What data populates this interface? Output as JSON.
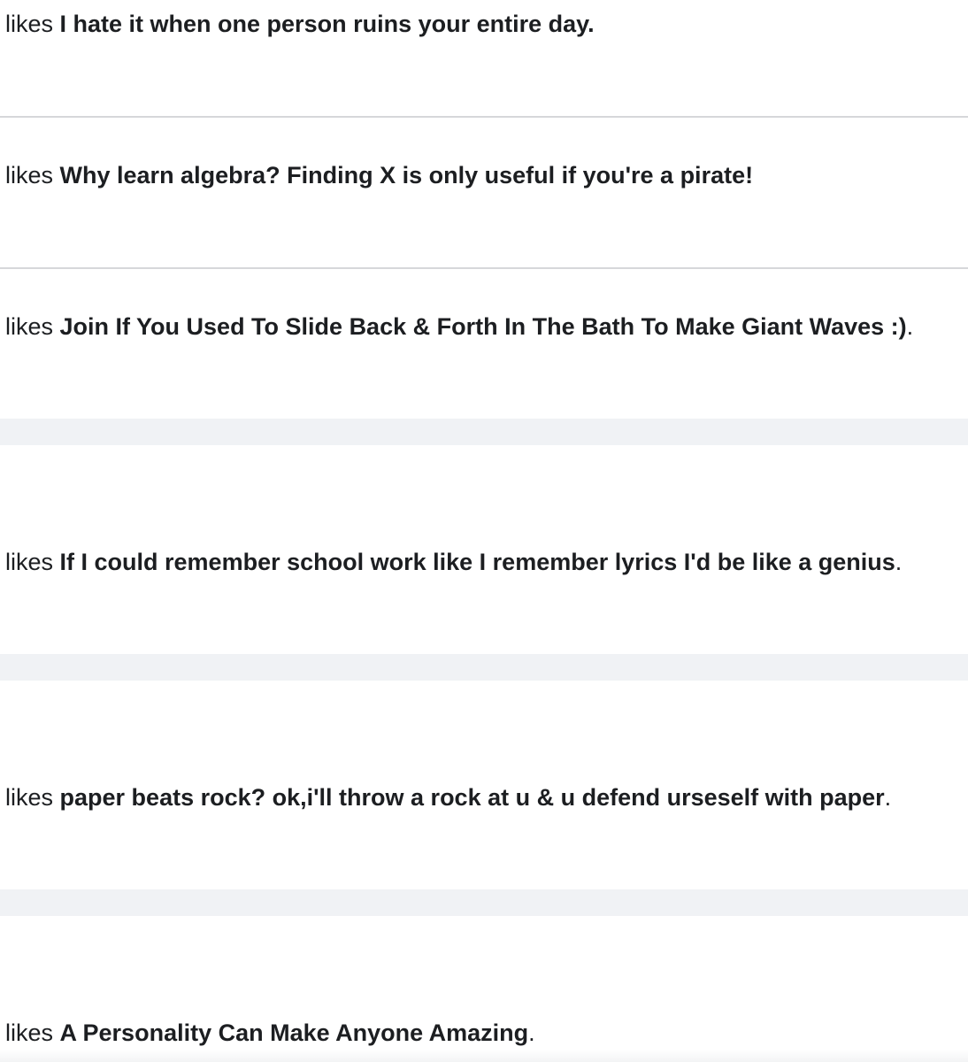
{
  "activity": [
    {
      "verb": "likes",
      "page": "I hate it when one person ruins your entire day",
      "end": "."
    },
    {
      "verb": "likes",
      "page": "Why learn algebra? Finding X is only useful if you're a pirate!",
      "end": ""
    },
    {
      "verb": "likes",
      "page": "Join If You Used To Slide Back & Forth In The Bath To Make Giant Waves :)",
      "end": "."
    },
    {
      "verb": "likes",
      "page": "If I could remember school work like I remember lyrics I'd be like a genius",
      "end": "."
    },
    {
      "verb": "likes",
      "page": "paper beats rock? ok,i'll throw a rock at u & u defend urseself with paper",
      "end": "."
    },
    {
      "verb": "likes",
      "page": "A Personality Can Make Anyone Amazing",
      "end": "."
    }
  ]
}
